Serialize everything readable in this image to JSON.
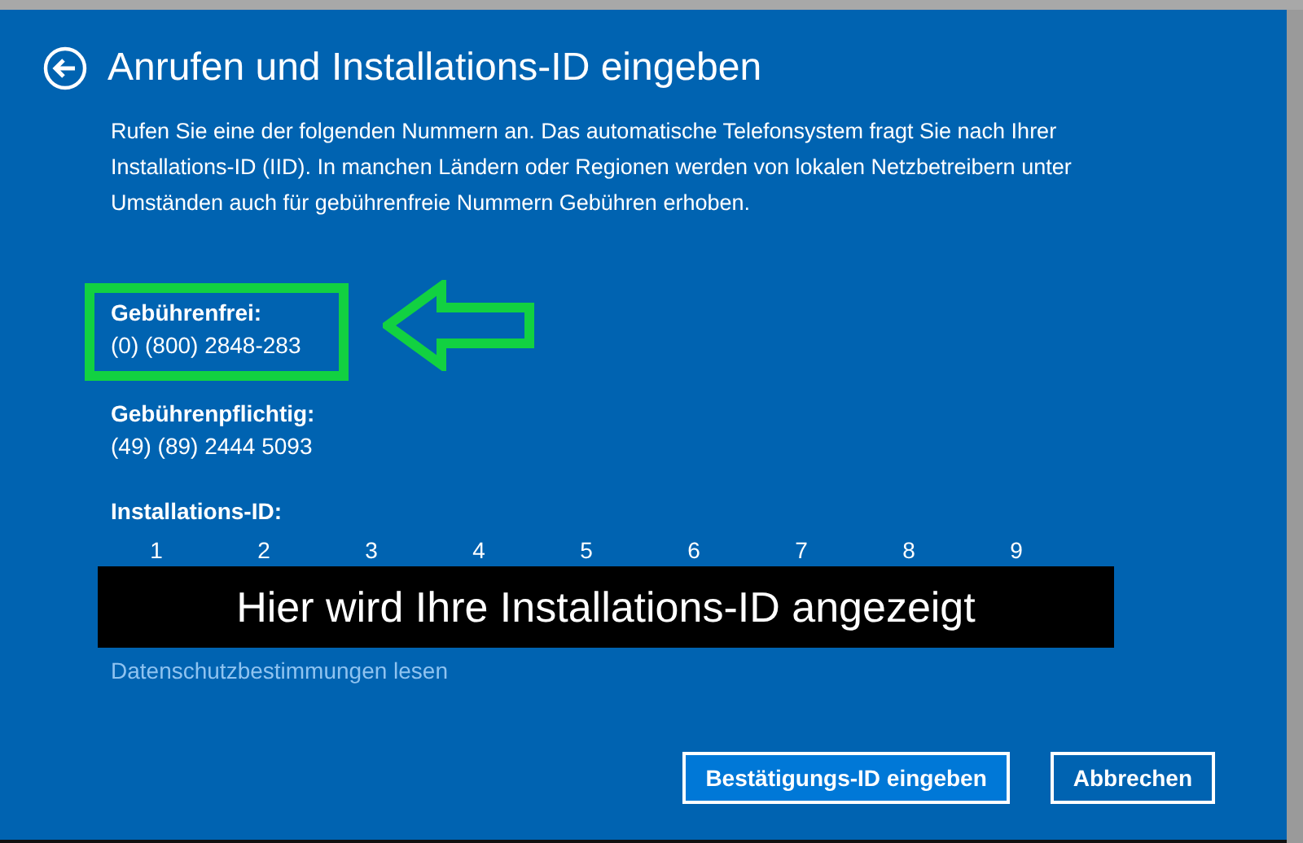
{
  "window": {
    "title": "Anrufen und Installations-ID eingeben"
  },
  "intro": "Rufen Sie eine der folgenden Nummern an. Das automatische Telefonsystem fragt Sie nach Ihrer Installations-ID (IID). In manchen Ländern oder Regionen werden von lokalen Netzbetreibern unter Umständen auch für gebührenfreie Nummern Gebühren erhoben.",
  "numbers": [
    {
      "label": "Gebührenfrei:",
      "value": "(0) (800) 2848-283",
      "highlighted": true
    },
    {
      "label": "Gebührenpflichtig:",
      "value": "(49) (89) 2444 5093",
      "highlighted": false
    }
  ],
  "installation_id": {
    "label": "Installations-ID:",
    "groups": [
      "1",
      "2",
      "3",
      "4",
      "5",
      "6",
      "7",
      "8",
      "9"
    ],
    "overlay": "Hier wird Ihre Installations-ID angezeigt"
  },
  "privacy_link": "Datenschutzbestimmungen lesen",
  "buttons": [
    {
      "label": "Bestätigungs-ID eingeben",
      "primary": true
    },
    {
      "label": "Abbrechen",
      "primary": false
    }
  ]
}
